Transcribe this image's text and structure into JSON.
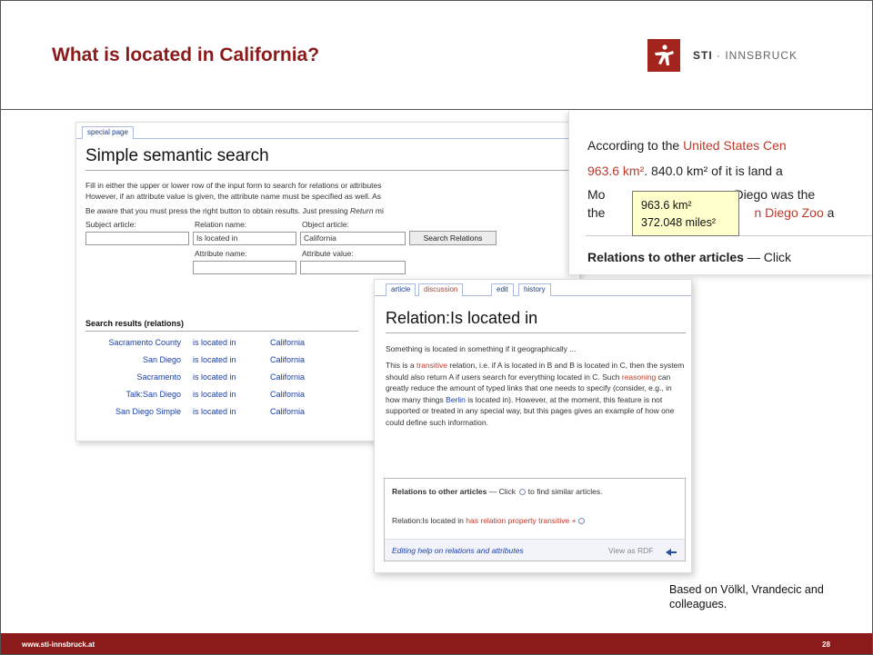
{
  "slide": {
    "title": "What is located in California?",
    "logo": {
      "brand": "STI",
      "separator": " · ",
      "name": "INNSBRUCK",
      "icon": "sti-logo-icon"
    },
    "credit": "Based on Völkl, Vrandecic and colleagues.",
    "footer": {
      "url": "www.sti-innsbruck.at",
      "page_number": "28"
    },
    "accent_color": "#8b1a1a"
  },
  "search_shot": {
    "tab": "special page",
    "heading": "Simple semantic search",
    "intro_line1": "Fill in either the upper or lower row of the input form to search for relations or attributes",
    "intro_line2": "However, if an attribute value is given, the attribute name must be specified as well. As",
    "intro_line3_pre": "Be aware that you must press the right button to obtain results. Just pressing ",
    "intro_line3_em": "Return",
    "intro_line3_post": " mi",
    "labels": {
      "subject": "Subject article:",
      "relation": "Relation name:",
      "object": "Object article:",
      "attribute_name": "Attribute name:",
      "attribute_value": "Attribute value:"
    },
    "fields": {
      "subject": "",
      "relation": "Is located in",
      "object": "California",
      "attribute_name": "",
      "attribute_value": ""
    },
    "search_button": "Search Relations",
    "results_heading": "Search results (relations)",
    "results": [
      {
        "subject": "Sacramento County",
        "relation": "is located in",
        "object": "California"
      },
      {
        "subject": "San Diego",
        "relation": "is located in",
        "object": "California"
      },
      {
        "subject": "Sacramento",
        "relation": "is located in",
        "object": "California"
      },
      {
        "subject": "Talk:San Diego",
        "relation": "is located in",
        "object": "California"
      },
      {
        "subject": "San Diego Simple",
        "relation": "is located in",
        "object": "California"
      }
    ]
  },
  "article_shot": {
    "line1_pre": "According to the ",
    "line1_link": "United States Cen",
    "line2_link": "963.6 km²",
    "line2_rest": ". 840.0 km² of it is land a",
    "line3_pre": "Mo",
    "line3_rest": "Diego was the",
    "line4_pre": "the",
    "line4_link": "n Diego Zoo",
    "line4_post": " a",
    "relations_label": "Relations to other articles",
    "relations_rest": " — Click",
    "tooltip_line1": "963.6 km²",
    "tooltip_line2": "372.048 miles²"
  },
  "relation_shot": {
    "tabs": [
      "article",
      "discussion",
      "edit",
      "history"
    ],
    "heading": "Relation:Is located in",
    "summary": "Something is located in something if it geographically ...",
    "body_1": "This is a ",
    "body_link_transitive": "transitive",
    "body_2": " relation, i.e. if A is located in B and B is located in C, then the system should also return A if users search for everything located in C. Such ",
    "body_link_reasoning": "reasoning",
    "body_3": " can greatly reduce the amount of typed links that one needs to specify (consider, e.g., in how many things ",
    "body_link_berlin": "Berlin",
    "body_4": " is located in). However, at the moment, this feature is not supported or treated in any special way, but this pages gives an example of how one could define such information.",
    "box_title": "Relations to other articles",
    "box_title_rest": " — Click ",
    "box_title_rest2": " to find similar articles.",
    "box_row_subject": "Relation:Is located in",
    "box_row_relation": "has relation property",
    "box_row_value": "transitive",
    "box_row_plus": "+",
    "footer_help": "Editing help on relations and attributes",
    "footer_rdf": "View as RDF"
  }
}
